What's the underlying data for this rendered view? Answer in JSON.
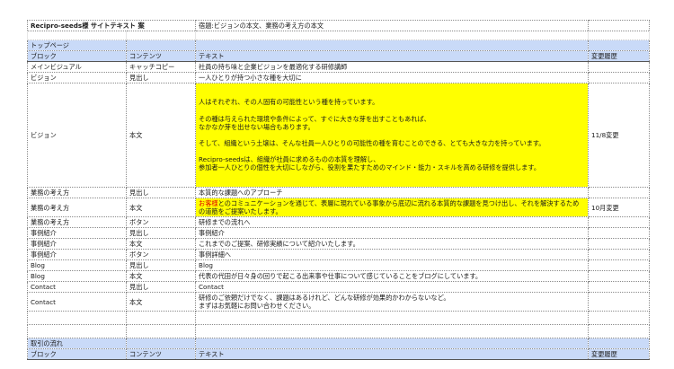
{
  "header": {
    "client_title": "Recipro-seeds様 サイトテキスト 案",
    "task": "宿題:ビジョンの本文、業務の考え方の本文"
  },
  "columns": {
    "block": "ブロック",
    "content": "コンテンツ",
    "text": "テキスト",
    "history": "変更履歴"
  },
  "sections": {
    "top_page": "トップページ",
    "flow": "取引の流れ"
  },
  "rows": {
    "main_visual": {
      "block": "メインビジュアル",
      "content": "キャッチコピー",
      "text": "社員の持ち味と企業ビジョンを最適化する研修講師",
      "history": ""
    },
    "vision_heading": {
      "block": "ビジョン",
      "content": "見出し",
      "text": "一人ひとりが持つ小さな種を大切に",
      "history": ""
    },
    "vision_body": {
      "block": "ビジョン",
      "content": "本文",
      "lines": [
        "人はそれぞれ、その人固有の可能性という種を持っています。",
        "",
        "その種は与えられた環境や条件によって、すぐに大きな芽を出すこともあれば、",
        "なかなか芽を出せない場合もあります。",
        "",
        "そして、組織という土壌は、そんな社員一人ひとりの可能性の種を育むことのできる、とても大きな力を持っています。",
        "",
        "Recipro-seedsは、組織が社員に求めるものの本質を理解し、",
        "参加者一人ひとりの個性を大切にしながら、役割を果たすためのマインド・能力・スキルを高める研修を提供します。"
      ],
      "history": "11/8変更"
    },
    "approach_heading": {
      "block": "業務の考え方",
      "content": "見出し",
      "text": "本質的な課題へのアプローチ",
      "history": ""
    },
    "approach_body": {
      "block": "業務の考え方",
      "content": "本文",
      "text_red": "お客様",
      "text_rest": "とのコミュニケーションを通じて、表層に現れている事象から底辺に流れる本質的な課題を見つけ出し、それを解決するための道筋をご提案いたします。",
      "history": "10月変更"
    },
    "approach_button": {
      "block": "業務の考え方",
      "content": "ボタン",
      "text": "研修までの流れへ",
      "history": ""
    },
    "cases_heading": {
      "block": "事例紹介",
      "content": "見出し",
      "text": "事例紹介",
      "history": ""
    },
    "cases_body": {
      "block": "事例紹介",
      "content": "本文",
      "text": "これまでのご提案、研修実績について紹介いたします。",
      "history": ""
    },
    "cases_button": {
      "block": "事例紹介",
      "content": "ボタン",
      "text": "事例詳細へ",
      "history": ""
    },
    "blog_heading": {
      "block": "Blog",
      "content": "見出し",
      "text": "Blog",
      "history": ""
    },
    "blog_body": {
      "block": "Blog",
      "content": "本文",
      "text": "代表の代田が日々身の回りで起こる出来事や仕事について感じていることをブログにしています。",
      "history": ""
    },
    "contact_heading": {
      "block": "Contact",
      "content": "見出し",
      "text": "Contact",
      "history": ""
    },
    "contact_body": {
      "block": "Contact",
      "content": "本文",
      "line1": "研修のご依頼だけでなく、課題はあるけれど、どんな研修が効果的かわからないなど。",
      "line2": "まずはお気軽にお問い合わせください。",
      "history": ""
    }
  }
}
